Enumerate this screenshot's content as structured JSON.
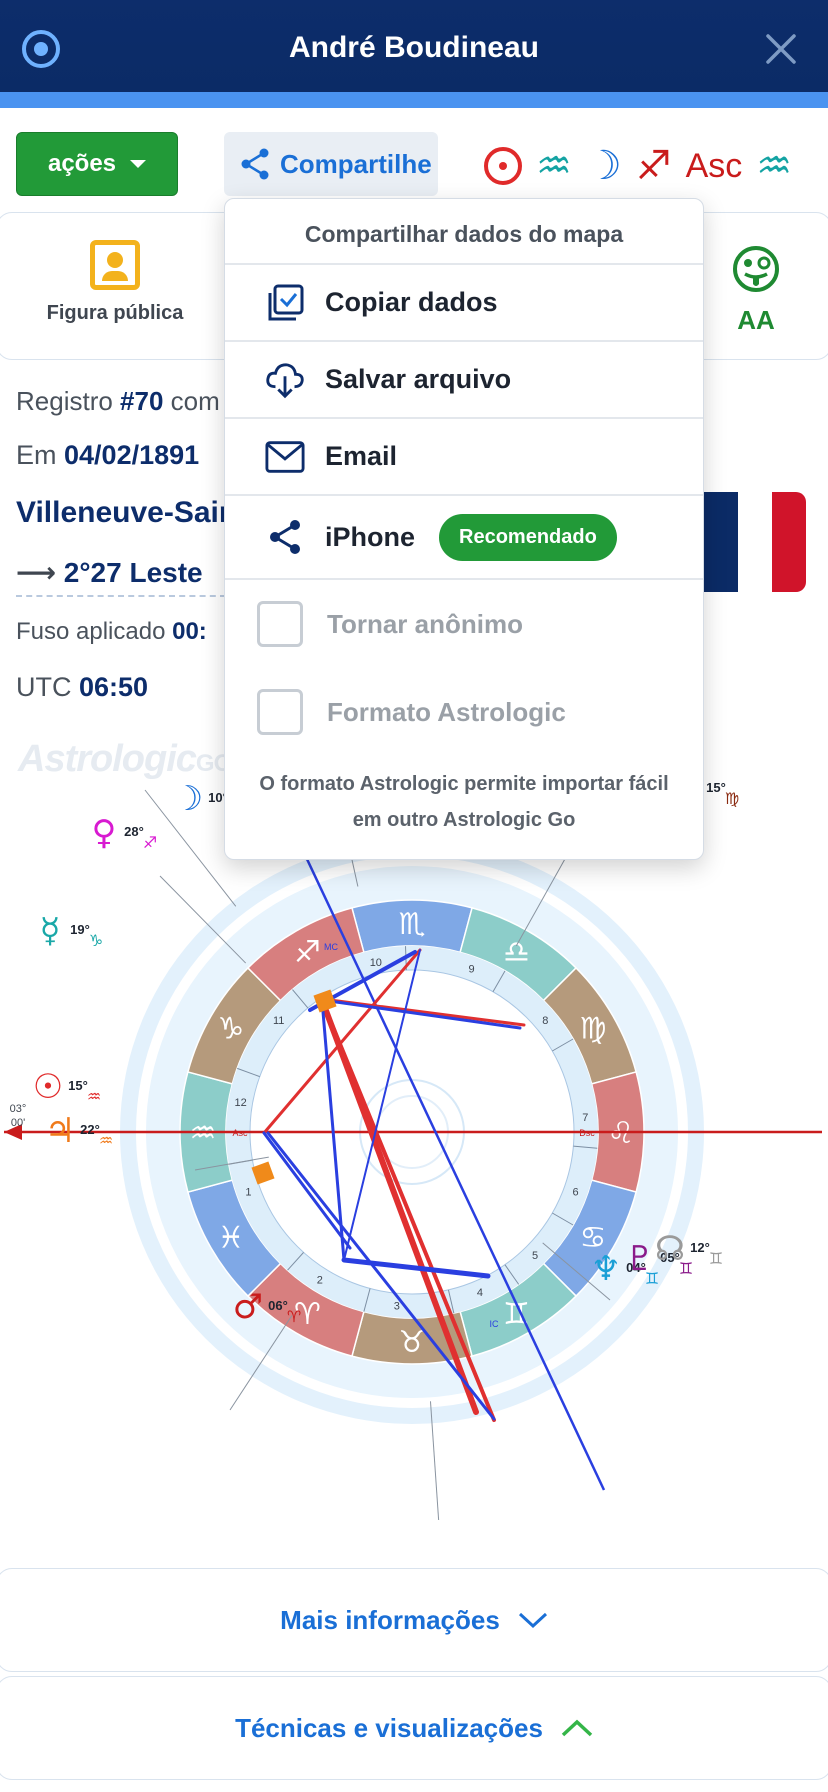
{
  "header": {
    "title": "André Boudineau",
    "logo_icon": "target-icon",
    "close_icon": "close-icon"
  },
  "toolbar": {
    "actions_label": "ações",
    "share_label": "Compartilhe",
    "ascendant_label": "Asc",
    "symbols": [
      "sun-icon",
      "aquarius-icon",
      "moon-icon",
      "sagittarius-icon",
      "asc-label",
      "aquarius-icon"
    ]
  },
  "card": {
    "public_figure_label": "Figura pública",
    "rating_label": "AA"
  },
  "info": {
    "record_prefix": "Registro ",
    "record_number": "#70",
    "record_suffix": " com",
    "date_prefix": "Em ",
    "date": "04/02/1891",
    "place": "Villeneuve-Sain",
    "longitude": "2°27 Leste",
    "timezone_prefix": "Fuso aplicado ",
    "timezone_value": "00:",
    "utc_prefix": "UTC ",
    "utc_value": "06:50"
  },
  "watermark": {
    "main": "Astrologic",
    "suffix": "GO"
  },
  "chart": {
    "signs_clockwise_from_top": [
      "♏",
      "♎",
      "♍",
      "♌",
      "♋",
      "♊",
      "♉",
      "♈",
      "♓",
      "♒",
      "♑",
      "♐"
    ],
    "house_numbers": [
      "1",
      "2",
      "3",
      "4",
      "5",
      "6",
      "7",
      "8",
      "9",
      "10",
      "11",
      "12"
    ],
    "axis_labels": {
      "asc": "Asc",
      "dsc": "Dsc",
      "mc": "MC",
      "ic": "IC"
    },
    "asc_degree": "03°\n00'",
    "planets": [
      {
        "glyph": "☽",
        "degree": "10°",
        "sign": "♐",
        "color": "#1a6fd6"
      },
      {
        "glyph": "♀",
        "degree": "28°",
        "sign": "♐",
        "color": "#d81ad1"
      },
      {
        "glyph": "☿",
        "degree": "19°",
        "sign": "♑",
        "color": "#1aa8a8"
      },
      {
        "glyph": "☉",
        "degree": "15°",
        "sign": "♒",
        "color": "#e02a2a"
      },
      {
        "glyph": "♃",
        "degree": "22°",
        "sign": "♒",
        "color": "#f07a1a"
      },
      {
        "glyph": "♂",
        "degree": "06°",
        "sign": "♈",
        "color": "#c91c1c"
      },
      {
        "glyph": "♆",
        "degree": "04°",
        "sign": "♊",
        "color": "#1a9fd6"
      },
      {
        "glyph": "♇",
        "degree": "05°",
        "sign": "♊",
        "color": "#8a1a8a"
      },
      {
        "glyph": "☊",
        "degree": "12°",
        "sign": "♊",
        "color": "#9a9a9a"
      },
      {
        "glyph": "♄",
        "degree": "15°",
        "sign": "♍",
        "color": "#8a2a10"
      }
    ]
  },
  "sections": {
    "more_info": "Mais informações",
    "techniques": "Técnicas e visualizações"
  },
  "share_menu": {
    "title": "Compartilhar dados do mapa",
    "copy_label": "Copiar dados",
    "save_label": "Salvar arquivo",
    "email_label": "Email",
    "iphone_label": "iPhone",
    "recommended_badge": "Recomendado",
    "anonymize_label": "Tornar anônimo",
    "format_label": "Formato Astrologic",
    "note": "O formato Astrologic permite importar fácil em outro Astrologic Go"
  },
  "colors": {
    "header": "#0b2b66",
    "accent": "#1a6fd6",
    "green": "#229a38",
    "flag": [
      "#0b2b66",
      "#ffffff",
      "#d0142a"
    ]
  }
}
